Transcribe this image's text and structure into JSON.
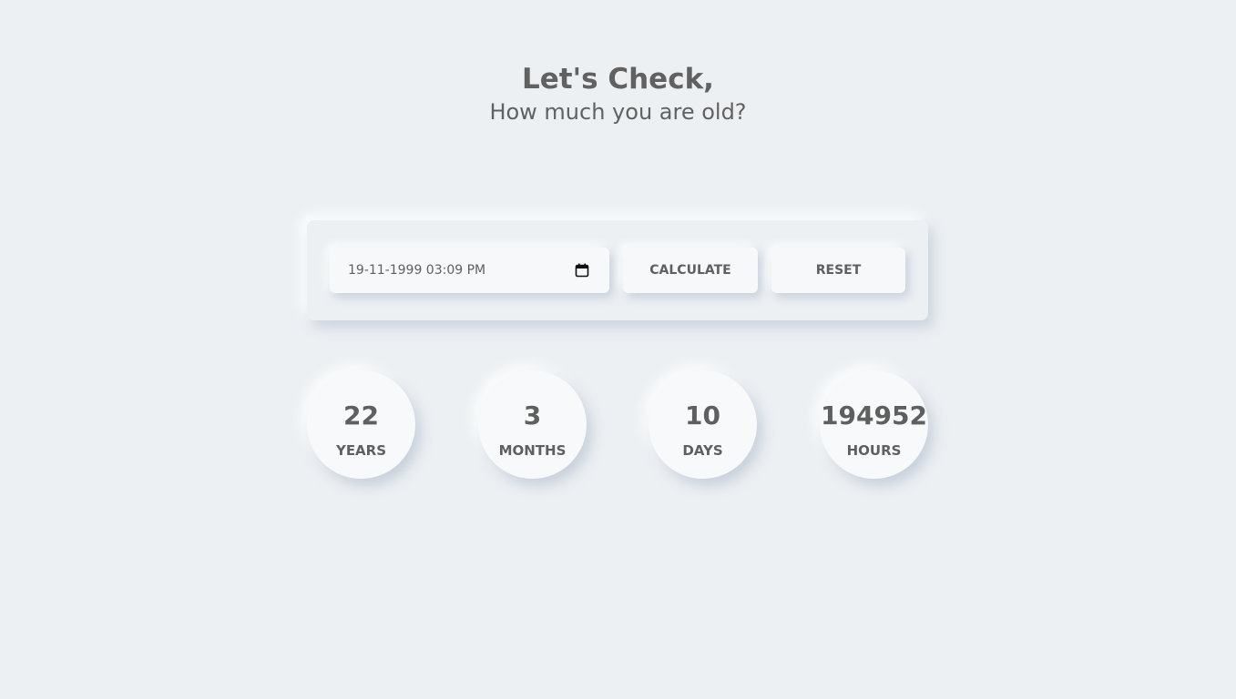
{
  "header": {
    "title": "Let's Check,",
    "subtitle": "How much you are old?"
  },
  "form": {
    "date_value": "19-11-1999 03:09 PM",
    "calculate_label": "CALCULATE",
    "reset_label": "RESET"
  },
  "results": [
    {
      "value": "22",
      "label": "YEARS"
    },
    {
      "value": "3",
      "label": "MONTHS"
    },
    {
      "value": "10",
      "label": "DAYS"
    },
    {
      "value": "194952",
      "label": "HOURS"
    }
  ],
  "icons": {
    "date_picker": "calendar-icon"
  },
  "colors": {
    "background": "#ecf0f3",
    "text": "#5f5f5f"
  }
}
